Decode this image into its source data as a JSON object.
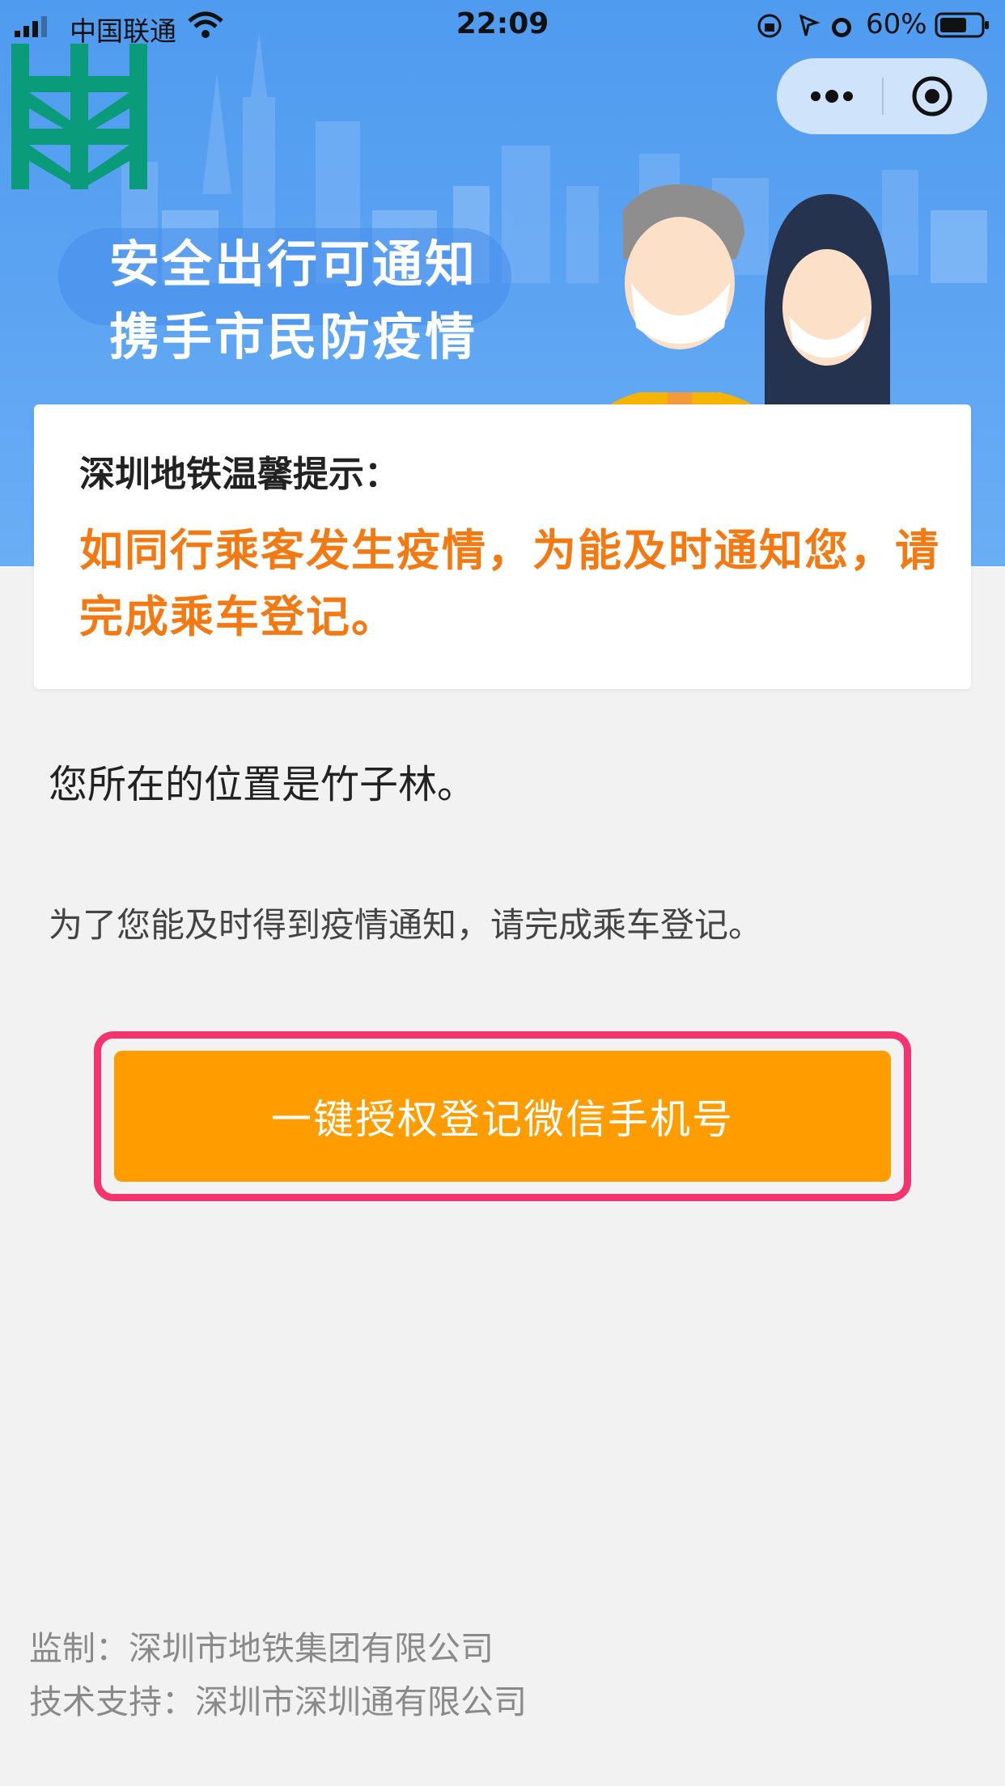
{
  "status_bar": {
    "carrier": "中国联通",
    "time": "22:09",
    "battery": "60%"
  },
  "header": {
    "capsule_more_icon": "more-dots-icon",
    "capsule_close_icon": "target-close-icon",
    "slogan_line1": "安全出行可通知",
    "slogan_line2": "携手市民防疫情",
    "logo_icon": "shenzhen-metro-logo",
    "colors": {
      "banner": "#5ea5f3",
      "logo": "#0a9b7a"
    }
  },
  "tip": {
    "title": "深圳地铁温馨提示：",
    "body_line1": "如同行乘客发生疫情，为能及时通知您，请",
    "body_line2": "完成乘车登记。",
    "color": "#f37a13"
  },
  "main": {
    "location": "您所在的位置是竹子林。",
    "notice": "为了您能及时得到疫情通知，请完成乘车登记。",
    "register_button": "一键授权登记微信手机号",
    "button_color": "#ff9c00",
    "highlight_color": "#f5336e"
  },
  "footer": {
    "supervisor": "监制：深圳市地铁集团有限公司",
    "tech_support": "技术支持：深圳市深圳通有限公司"
  }
}
